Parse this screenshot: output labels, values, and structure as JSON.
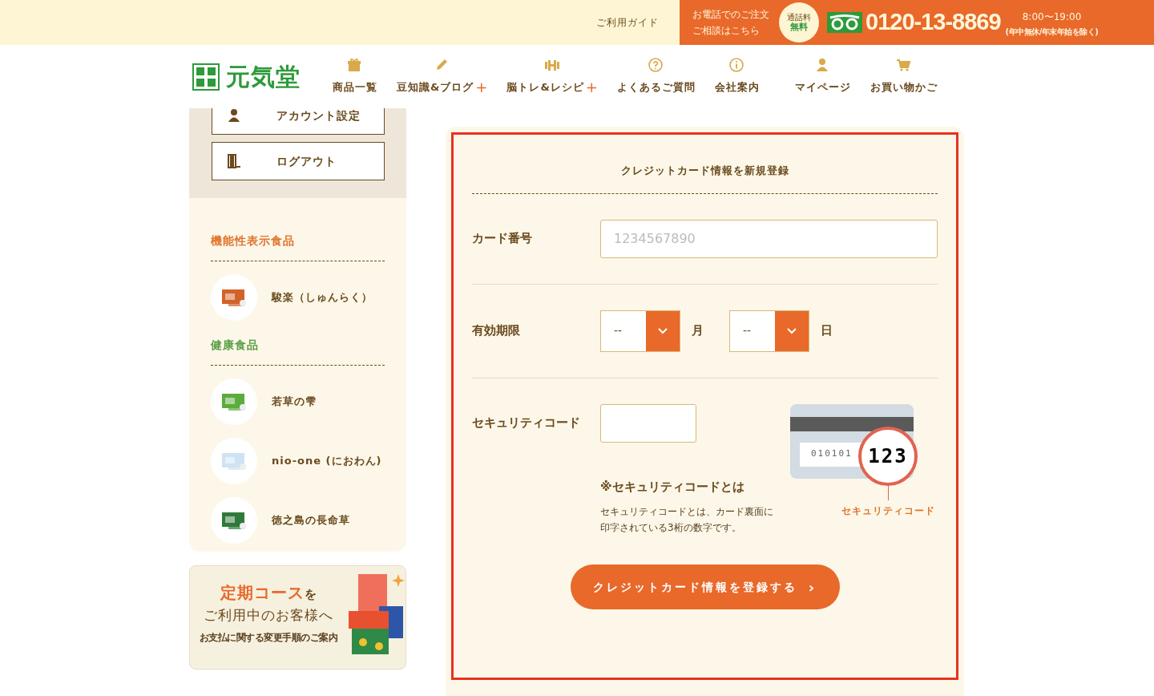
{
  "top_bar": {
    "guide_link": "ご利用ガイド",
    "phone_lines": [
      "お電話でのご注文",
      "ご相談はこちら"
    ],
    "free_badge": [
      "通話料",
      "無料"
    ],
    "phone_number": "0120-13-8869",
    "hours": "8:00〜19:00",
    "hours_note": "(年中無休/年末年始を除く)"
  },
  "header": {
    "logo_text": "元気堂",
    "nav": [
      {
        "label": "商品一覧"
      },
      {
        "label": "豆知識&ブログ",
        "plus": "+"
      },
      {
        "label": "脳トレ&レシピ",
        "plus": "+"
      },
      {
        "label": "よくあるご質問"
      },
      {
        "label": "会社案内"
      },
      {
        "label": "マイページ"
      },
      {
        "label": "お買い物かご"
      }
    ]
  },
  "sidebar": {
    "account_buttons": [
      {
        "label": "アカウント設定"
      },
      {
        "label": "ログアウト"
      }
    ],
    "categories": [
      {
        "title": "機能性表示食品",
        "color": "#e0742e",
        "products": [
          {
            "name": "駿楽（しゅんらく）"
          }
        ]
      },
      {
        "title": "健康食品",
        "color": "#5aa046",
        "products": [
          {
            "name": "若草の雫"
          },
          {
            "name": "nio-one (におわん)"
          },
          {
            "name": "徳之島の長命草"
          }
        ]
      }
    ],
    "banner": {
      "title_highlight": "定期コース",
      "title_rest": "を",
      "line2": "ご利用中のお客様へ",
      "line3": "お支払に関する変更手順のご案内"
    }
  },
  "form": {
    "title": "クレジットカード情報を新規登録",
    "card_number": {
      "label": "カード番号",
      "placeholder": "1234567890"
    },
    "expiry": {
      "label": "有効期限",
      "selects": [
        {
          "value": "--",
          "unit": "月"
        },
        {
          "value": "--",
          "unit": "日"
        }
      ]
    },
    "security": {
      "label": "セキュリティコード",
      "note_title": "※セキュリティコードとは",
      "note_text": "セキュリティコードとは、カード裏面に印字されている3桁の数字です。",
      "card_digits": "010101",
      "card_code": "123",
      "card_caption": "セキュリティコード"
    },
    "submit": {
      "label": "クレジットカード情報を登録する",
      "arrow": "›"
    }
  }
}
